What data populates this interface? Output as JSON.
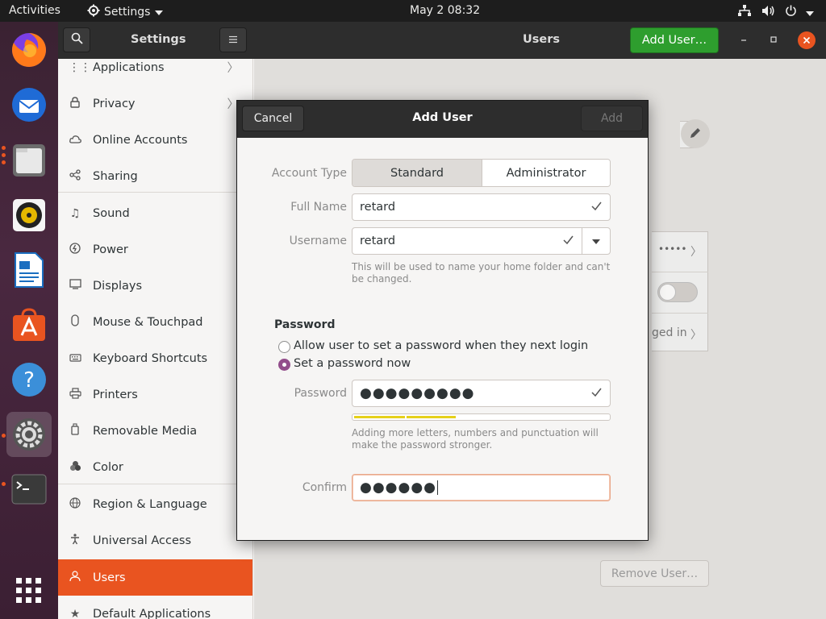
{
  "topbar": {
    "activities": "Activities",
    "app_menu": "Settings",
    "clock": "May 2  08:32"
  },
  "dock": {
    "apps": [
      "firefox-icon",
      "thunderbird-icon",
      "files-icon",
      "rhythmbox-icon",
      "writer-icon",
      "software-icon",
      "help-icon",
      "settings-icon",
      "terminal-icon",
      "app-grid-icon"
    ]
  },
  "headerbar": {
    "sidebar_title": "Settings",
    "page_title": "Users",
    "add_user_label": "Add User…"
  },
  "sidebar": {
    "items": [
      {
        "label": "Applications",
        "icon": "apps-icon",
        "arrow": true
      },
      {
        "label": "Privacy",
        "icon": "lock-icon",
        "arrow": true
      },
      {
        "label": "Online Accounts",
        "icon": "cloud-icon"
      },
      {
        "label": "Sharing",
        "icon": "share-icon"
      },
      {
        "label": "Sound",
        "icon": "music-icon"
      },
      {
        "label": "Power",
        "icon": "power-icon"
      },
      {
        "label": "Displays",
        "icon": "display-icon"
      },
      {
        "label": "Mouse & Touchpad",
        "icon": "mouse-icon"
      },
      {
        "label": "Keyboard Shortcuts",
        "icon": "keyboard-icon"
      },
      {
        "label": "Printers",
        "icon": "printer-icon"
      },
      {
        "label": "Removable Media",
        "icon": "media-icon"
      },
      {
        "label": "Color",
        "icon": "color-icon"
      },
      {
        "label": "Region & Language",
        "icon": "globe-icon"
      },
      {
        "label": "Universal Access",
        "icon": "access-icon"
      },
      {
        "label": "Users",
        "icon": "users-icon",
        "selected": true
      },
      {
        "label": "Default Applications",
        "icon": "star-icon"
      }
    ]
  },
  "content": {
    "password_dots": "•••••",
    "logged_in_fragment": "ged in",
    "remove_user_label": "Remove User…"
  },
  "dialog": {
    "title": "Add User",
    "cancel_label": "Cancel",
    "add_label": "Add",
    "account_type_label": "Account Type",
    "account_types": [
      "Standard",
      "Administrator"
    ],
    "selected_account_type": "Standard",
    "full_name_label": "Full Name",
    "full_name_value": "retard",
    "username_label": "Username",
    "username_value": "retard",
    "username_hint": "This will be used to name your home folder and can't be changed.",
    "password_section_title": "Password",
    "radio_option_1": "Allow user to set a password when they next login",
    "radio_option_2": "Set a password now",
    "selected_radio": 2,
    "password_label": "Password",
    "password_value": "●●●●●●●●●",
    "strength_level": 0.4,
    "strength_hint": "Adding more letters, numbers and punctuation will make the password stronger.",
    "confirm_label": "Confirm",
    "confirm_value": "●●●●●●"
  },
  "colors": {
    "accent": "#e95420",
    "add_user_green": "#2e9e2e",
    "strength_yellow": "#e5d01a",
    "radio_purple": "#924d8b"
  }
}
